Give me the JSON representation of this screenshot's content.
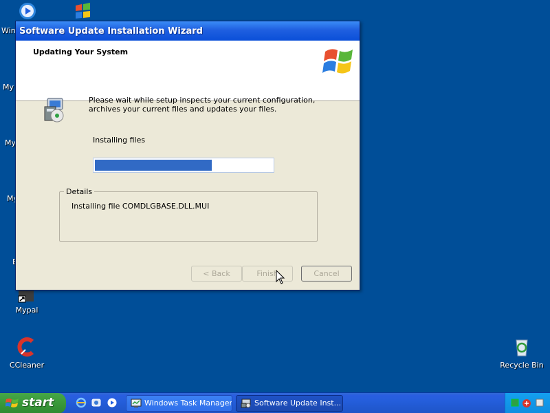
{
  "desktop": {
    "icons": {
      "mypal": "Mypal",
      "ccleaner": "CCleaner",
      "recycle_bin": "Recycle Bin"
    },
    "partial_labels": {
      "windows_media": "Wind",
      "my1": "My",
      "my2": "My",
      "my3": "My",
      "b": "E"
    }
  },
  "wizard": {
    "title": "Software Update Installation Wizard",
    "header_title": "Updating Your System",
    "message": "Please wait while setup inspects your current configuration, archives your current files and updates your files.",
    "status_text": "Installing files",
    "progress_fraction": 0.66,
    "details_legend": "Details",
    "details_text": "Installing file COMDLGBASE.DLL.MUI",
    "buttons": {
      "back": "< Back",
      "finish": "Finish",
      "cancel": "Cancel"
    }
  },
  "taskbar": {
    "start_label": "start",
    "tasks": [
      {
        "label": "Windows Task Manager",
        "icon": "task-manager-icon"
      },
      {
        "label": "Software Update Inst...",
        "icon": "installer-icon",
        "active": true
      }
    ]
  },
  "colors": {
    "desktop": "#004e98",
    "window_face": "#ece9d8",
    "titlebar": "#0a4fd8",
    "progress": "#316ac5",
    "start_button": "#3b9a3b",
    "taskbar": "#245edb",
    "tray": "#0f8de0"
  }
}
